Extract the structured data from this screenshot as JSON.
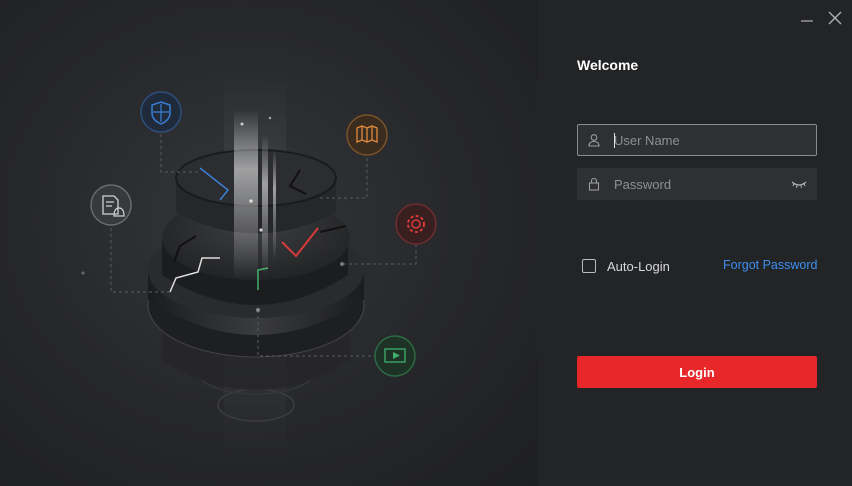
{
  "window": {
    "controls": [
      "minimize-icon",
      "close-icon"
    ]
  },
  "illustration": {
    "icons": [
      "shield-icon",
      "map-icon",
      "document-bell-icon",
      "gear-icon",
      "video-play-icon"
    ],
    "colors": {
      "shield": "#3a7fd6",
      "map": "#e08a3c",
      "gear": "#d83a3a",
      "video": "#3fb06a",
      "document": "#b5b6b8"
    }
  },
  "login": {
    "title": "Welcome",
    "username": {
      "placeholder": "User Name",
      "value": ""
    },
    "password": {
      "placeholder": "Password",
      "value": ""
    },
    "auto_login_label": "Auto-Login",
    "auto_login_checked": false,
    "forgot_password": "Forgot Password",
    "login_button": "Login",
    "accent_color": "#e8272b",
    "link_color": "#3f8ff0"
  }
}
